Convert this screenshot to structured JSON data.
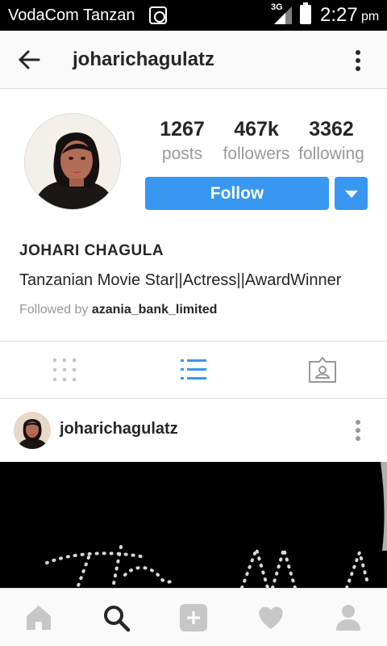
{
  "status_bar": {
    "carrier": "VodaCom Tanzan",
    "network": "3G",
    "time": "2:27",
    "ampm": "pm"
  },
  "header": {
    "username": "joharichagulatz",
    "back_icon": "arrow-left-icon",
    "menu_icon": "more-vertical-icon"
  },
  "profile": {
    "stats": [
      {
        "value": "1267",
        "label": "posts"
      },
      {
        "value": "467k",
        "label": "followers"
      },
      {
        "value": "3362",
        "label": "following"
      }
    ],
    "follow_label": "Follow",
    "name": "JOHARI CHAGULA",
    "bio": "Tanzanian Movie Star||Actress||AwardWinner",
    "followed_by_prefix": "Followed by",
    "followed_by_user": "azania_bank_limited"
  },
  "view_tabs": [
    {
      "icon": "grid-icon",
      "active": false
    },
    {
      "icon": "list-icon",
      "active": true
    },
    {
      "icon": "tagged-photos-icon",
      "active": false
    }
  ],
  "post": {
    "username": "joharichagulatz"
  },
  "bottom_nav": [
    {
      "icon": "home-icon"
    },
    {
      "icon": "search-icon"
    },
    {
      "icon": "add-post-icon"
    },
    {
      "icon": "heart-icon"
    },
    {
      "icon": "profile-icon"
    }
  ],
  "colors": {
    "accent": "#3897f0",
    "text": "#262626",
    "muted": "#999999",
    "divider": "#dbdbdb",
    "inactive_icon": "#c7c7c7"
  }
}
